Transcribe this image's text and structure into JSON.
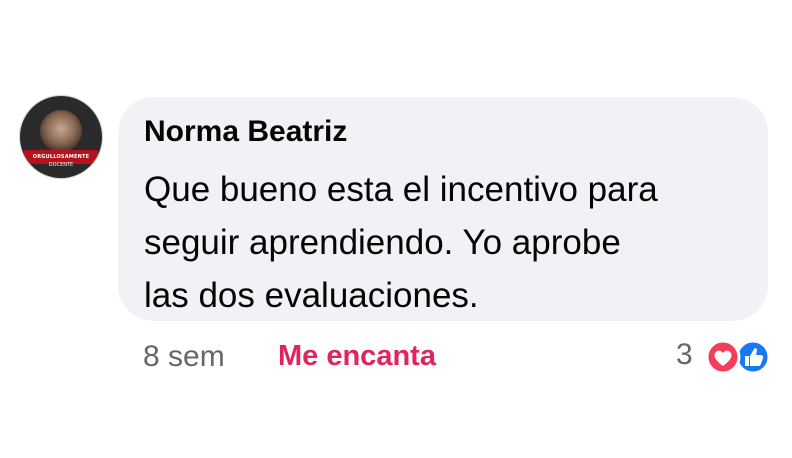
{
  "comment": {
    "author": "Norma Beatriz",
    "lines": [
      "Que bueno esta el incentivo para",
      "seguir aprendiendo. Yo aprobe",
      "las dos evaluaciones."
    ],
    "avatar": {
      "banner_text": "ORGULLOSAMENTE",
      "sub_text": "DOCENTE"
    }
  },
  "meta": {
    "time": "8 sem",
    "reaction_label": "Me encanta",
    "reaction_count": "3",
    "reaction_icons": [
      "love-icon",
      "like-icon"
    ]
  },
  "colors": {
    "bubble": "#f0f2f5",
    "love": "#e0245e",
    "like": "#1877f2",
    "muted": "#65676b"
  }
}
